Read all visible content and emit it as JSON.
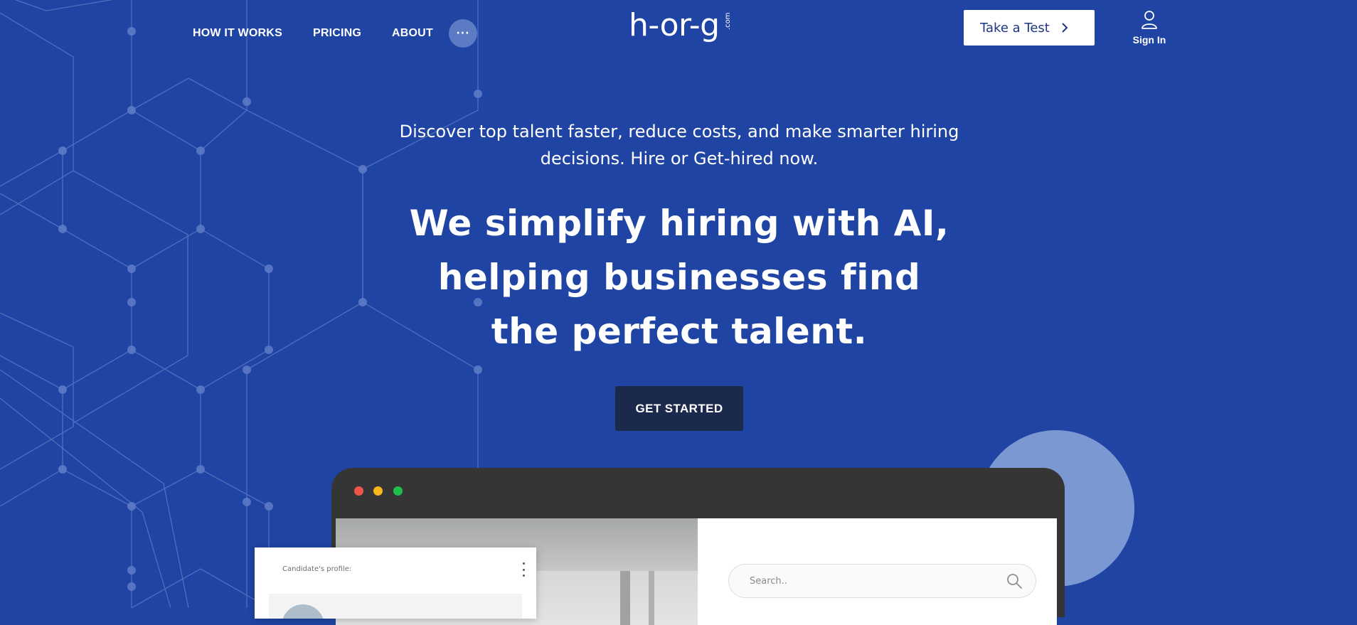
{
  "colors": {
    "background": "#1f44a3",
    "cta_background": "#1b2a4c",
    "take_test_text": "#1e3680",
    "decor_circle": "#7c98d2",
    "window_dots": [
      "#ee5548",
      "#f6b61c",
      "#1fbd4c"
    ]
  },
  "nav": {
    "items": [
      {
        "label": "HOW IT WORKS"
      },
      {
        "label": "PRICING"
      },
      {
        "label": "ABOUT"
      }
    ],
    "more_label": "···",
    "more_icon": "ellipsis-icon"
  },
  "logo": {
    "text": "h-or-g",
    "suffix": ".com"
  },
  "header": {
    "take_test_label": "Take a Test",
    "take_test_icon": "chevron-right-icon",
    "sign_in_label": "Sign In",
    "sign_in_icon": "user-icon"
  },
  "hero": {
    "subtitle": "Discover top talent faster, reduce costs, and make smarter hiring decisions. Hire or Get-hired now.",
    "title": "We simplify hiring with AI, helping businesses find the perfect talent.",
    "cta_label": "GET STARTED"
  },
  "mockup": {
    "search_placeholder": "Search..",
    "search_icon": "search-icon",
    "profile_label": "Candidate's profile:",
    "profile_menu_icon": "vertical-dots-icon"
  }
}
